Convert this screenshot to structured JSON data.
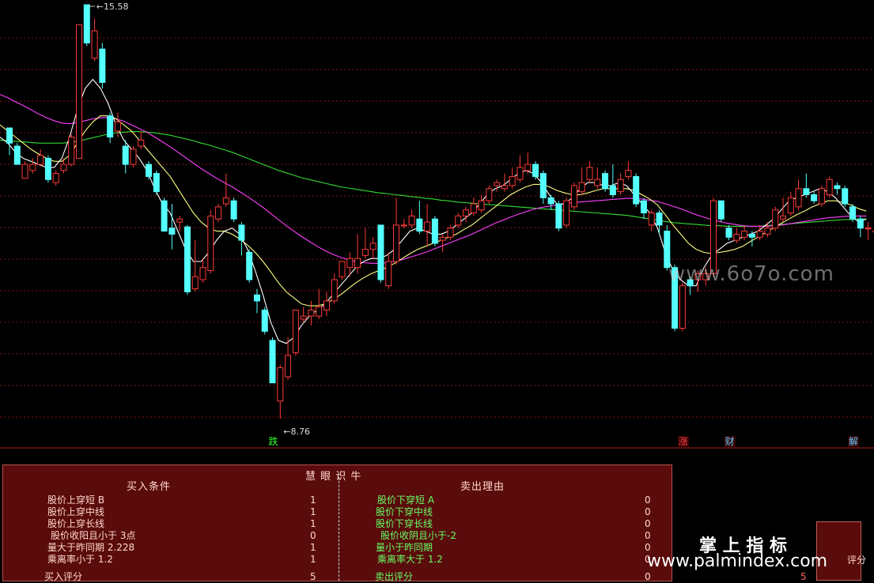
{
  "chart_data": {
    "type": "candlestick",
    "ylim": [
      8.5,
      15.8
    ],
    "price_high_label": "15.58",
    "price_low_label": "8.76",
    "colors": {
      "up": "#ff3a3a",
      "down": "#54ffff",
      "ma_short": "#ffffff",
      "ma_mid": "#ffff80",
      "ma_long": "#ff40ff",
      "ma_longest": "#33dd33"
    },
    "candles": [
      {
        "o": 13.55,
        "c": 13.3,
        "h": 13.55,
        "l": 13.1
      },
      {
        "o": 13.25,
        "c": 12.95,
        "h": 13.3,
        "l": 12.95
      },
      {
        "o": 12.72,
        "c": 12.95,
        "h": 13.0,
        "l": 12.75
      },
      {
        "o": 12.85,
        "c": 12.95,
        "h": 13.05,
        "l": 12.8
      },
      {
        "o": 12.95,
        "c": 13.1,
        "h": 13.2,
        "l": 12.92
      },
      {
        "o": 13.05,
        "c": 12.7,
        "h": 13.1,
        "l": 12.65
      },
      {
        "o": 12.65,
        "c": 12.8,
        "h": 12.85,
        "l": 12.6
      },
      {
        "o": 12.85,
        "c": 12.95,
        "h": 13.05,
        "l": 12.8
      },
      {
        "o": 12.95,
        "c": 13.4,
        "h": 13.45,
        "l": 12.92
      },
      {
        "o": 13.05,
        "c": 15.25,
        "h": 15.25,
        "l": 13.05
      },
      {
        "o": 15.58,
        "c": 14.95,
        "h": 15.58,
        "l": 14.9
      },
      {
        "o": 14.7,
        "c": 15.15,
        "h": 15.35,
        "l": 14.65
      },
      {
        "o": 14.85,
        "c": 14.3,
        "h": 14.95,
        "l": 14.2
      },
      {
        "o": 13.75,
        "c": 13.4,
        "h": 13.8,
        "l": 13.3
      },
      {
        "o": 13.5,
        "c": 13.65,
        "h": 13.8,
        "l": 13.4
      },
      {
        "o": 13.25,
        "c": 12.95,
        "h": 13.35,
        "l": 12.8
      },
      {
        "o": 12.95,
        "c": 13.2,
        "h": 13.25,
        "l": 12.9
      },
      {
        "o": 13.25,
        "c": 13.35,
        "h": 13.5,
        "l": 13.2
      },
      {
        "o": 12.95,
        "c": 12.75,
        "h": 13.0,
        "l": 12.7
      },
      {
        "o": 12.8,
        "c": 12.5,
        "h": 12.85,
        "l": 12.45
      },
      {
        "o": 12.35,
        "c": 11.85,
        "h": 12.4,
        "l": 11.85
      },
      {
        "o": 11.9,
        "c": 11.8,
        "h": 12.3,
        "l": 11.55
      },
      {
        "o": 12.0,
        "c": 12.05,
        "h": 12.1,
        "l": 11.85
      },
      {
        "o": 11.92,
        "c": 10.85,
        "h": 11.95,
        "l": 10.8
      },
      {
        "o": 10.9,
        "c": 11.1,
        "h": 11.7,
        "l": 10.85
      },
      {
        "o": 11.05,
        "c": 11.25,
        "h": 11.4,
        "l": 11.0
      },
      {
        "o": 11.2,
        "c": 12.1,
        "h": 12.2,
        "l": 11.15
      },
      {
        "o": 12.05,
        "c": 12.25,
        "h": 12.3,
        "l": 12.0
      },
      {
        "o": 12.3,
        "c": 12.4,
        "h": 12.8,
        "l": 12.25
      },
      {
        "o": 12.35,
        "c": 12.05,
        "h": 12.4,
        "l": 12.0
      },
      {
        "o": 11.95,
        "c": 11.7,
        "h": 12.0,
        "l": 11.45
      },
      {
        "o": 11.5,
        "c": 11.05,
        "h": 11.55,
        "l": 11.0
      },
      {
        "o": 10.8,
        "c": 10.7,
        "h": 10.9,
        "l": 10.5
      },
      {
        "o": 10.55,
        "c": 10.2,
        "h": 10.6,
        "l": 10.15
      },
      {
        "o": 10.05,
        "c": 9.35,
        "h": 10.1,
        "l": 9.35
      },
      {
        "o": 9.05,
        "c": 9.6,
        "h": 9.65,
        "l": 8.76
      },
      {
        "o": 9.45,
        "c": 9.8,
        "h": 10.1,
        "l": 9.4
      },
      {
        "o": 9.85,
        "c": 10.55,
        "h": 10.55,
        "l": 9.8
      },
      {
        "o": 10.4,
        "c": 10.45,
        "h": 10.6,
        "l": 10.35
      },
      {
        "o": 10.45,
        "c": 10.55,
        "h": 10.7,
        "l": 10.3
      },
      {
        "o": 10.45,
        "c": 10.6,
        "h": 10.9,
        "l": 10.4
      },
      {
        "o": 10.55,
        "c": 10.7,
        "h": 10.85,
        "l": 10.45
      },
      {
        "o": 10.7,
        "c": 11.05,
        "h": 11.15,
        "l": 10.65
      },
      {
        "o": 11.1,
        "c": 11.35,
        "h": 11.35,
        "l": 11.05
      },
      {
        "o": 11.25,
        "c": 11.4,
        "h": 11.5,
        "l": 11.1
      },
      {
        "o": 11.25,
        "c": 11.4,
        "h": 11.8,
        "l": 11.15
      },
      {
        "o": 11.45,
        "c": 11.55,
        "h": 11.9,
        "l": 11.4
      },
      {
        "o": 11.55,
        "c": 11.65,
        "h": 11.75,
        "l": 11.4
      },
      {
        "o": 11.95,
        "c": 11.05,
        "h": 11.95,
        "l": 11.0
      },
      {
        "o": 10.95,
        "c": 11.35,
        "h": 11.5,
        "l": 10.9
      },
      {
        "o": 11.35,
        "c": 11.95,
        "h": 12.4,
        "l": 11.3
      },
      {
        "o": 11.95,
        "c": 11.95,
        "h": 12.05,
        "l": 11.9
      },
      {
        "o": 11.95,
        "c": 12.1,
        "h": 12.2,
        "l": 11.9
      },
      {
        "o": 12.05,
        "c": 11.85,
        "h": 12.35,
        "l": 11.8
      },
      {
        "o": 11.85,
        "c": 12.0,
        "h": 12.3,
        "l": 11.6
      },
      {
        "o": 12.05,
        "c": 11.65,
        "h": 12.1,
        "l": 11.6
      },
      {
        "o": 11.7,
        "c": 11.75,
        "h": 11.8,
        "l": 11.5
      },
      {
        "o": 11.75,
        "c": 11.9,
        "h": 11.95,
        "l": 11.7
      },
      {
        "o": 11.95,
        "c": 12.1,
        "h": 12.15,
        "l": 11.9
      },
      {
        "o": 12.1,
        "c": 12.2,
        "h": 12.25,
        "l": 12.0
      },
      {
        "o": 12.15,
        "c": 12.3,
        "h": 12.4,
        "l": 12.1
      },
      {
        "o": 12.2,
        "c": 12.35,
        "h": 12.45,
        "l": 12.15
      },
      {
        "o": 12.35,
        "c": 12.55,
        "h": 12.6,
        "l": 12.3
      },
      {
        "o": 12.6,
        "c": 12.65,
        "h": 12.7,
        "l": 12.5
      },
      {
        "o": 12.55,
        "c": 12.6,
        "h": 12.8,
        "l": 12.5
      },
      {
        "o": 12.6,
        "c": 12.75,
        "h": 12.9,
        "l": 12.55
      },
      {
        "o": 12.7,
        "c": 12.9,
        "h": 13.1,
        "l": 12.65
      },
      {
        "o": 12.85,
        "c": 12.95,
        "h": 13.15,
        "l": 12.8
      },
      {
        "o": 12.95,
        "c": 12.75,
        "h": 13.0,
        "l": 12.7
      },
      {
        "o": 12.8,
        "c": 12.4,
        "h": 12.85,
        "l": 12.3
      },
      {
        "o": 12.4,
        "c": 12.3,
        "h": 12.45,
        "l": 12.2
      },
      {
        "o": 12.3,
        "c": 11.9,
        "h": 12.35,
        "l": 11.85
      },
      {
        "o": 11.95,
        "c": 12.35,
        "h": 12.4,
        "l": 11.9
      },
      {
        "o": 12.25,
        "c": 12.6,
        "h": 12.65,
        "l": 12.2
      },
      {
        "o": 12.5,
        "c": 12.65,
        "h": 12.9,
        "l": 12.45
      },
      {
        "o": 12.7,
        "c": 12.9,
        "h": 13.0,
        "l": 12.65
      },
      {
        "o": 12.6,
        "c": 12.7,
        "h": 12.9,
        "l": 12.55
      },
      {
        "o": 12.8,
        "c": 12.55,
        "h": 12.85,
        "l": 12.5
      },
      {
        "o": 12.6,
        "c": 12.45,
        "h": 12.95,
        "l": 12.4
      },
      {
        "o": 12.5,
        "c": 12.7,
        "h": 12.8,
        "l": 12.45
      },
      {
        "o": 12.75,
        "c": 12.85,
        "h": 13.0,
        "l": 12.7
      },
      {
        "o": 12.75,
        "c": 12.3,
        "h": 12.8,
        "l": 12.25
      },
      {
        "o": 12.35,
        "c": 12.15,
        "h": 12.4,
        "l": 12.05
      },
      {
        "o": 11.95,
        "c": 12.15,
        "h": 12.2,
        "l": 11.85
      },
      {
        "o": 12.15,
        "c": 11.95,
        "h": 12.2,
        "l": 11.8
      },
      {
        "o": 11.85,
        "c": 11.25,
        "h": 11.95,
        "l": 11.2
      },
      {
        "o": 11.25,
        "c": 10.25,
        "h": 11.3,
        "l": 10.2
      },
      {
        "o": 10.25,
        "c": 10.95,
        "h": 11.0,
        "l": 10.2
      },
      {
        "o": 11.05,
        "c": 10.95,
        "h": 11.1,
        "l": 10.8
      },
      {
        "o": 11.05,
        "c": 11.15,
        "h": 11.2,
        "l": 10.85
      },
      {
        "o": 11.05,
        "c": 11.15,
        "h": 11.25,
        "l": 10.95
      },
      {
        "o": 11.15,
        "c": 12.35,
        "h": 12.4,
        "l": 11.1
      },
      {
        "o": 12.35,
        "c": 12.05,
        "h": 12.35,
        "l": 12.0
      },
      {
        "o": 11.9,
        "c": 11.75,
        "h": 11.95,
        "l": 11.7
      },
      {
        "o": 11.7,
        "c": 11.8,
        "h": 11.9,
        "l": 11.65
      },
      {
        "o": 11.75,
        "c": 11.85,
        "h": 11.95,
        "l": 11.7
      },
      {
        "o": 11.8,
        "c": 11.75,
        "h": 11.85,
        "l": 11.6
      },
      {
        "o": 11.75,
        "c": 11.85,
        "h": 11.95,
        "l": 11.7
      },
      {
        "o": 11.8,
        "c": 11.9,
        "h": 12.0,
        "l": 11.75
      },
      {
        "o": 11.9,
        "c": 12.2,
        "h": 12.25,
        "l": 11.85
      },
      {
        "o": 12.05,
        "c": 12.1,
        "h": 12.4,
        "l": 12.0
      },
      {
        "o": 12.15,
        "c": 12.4,
        "h": 12.5,
        "l": 12.1
      },
      {
        "o": 12.25,
        "c": 12.55,
        "h": 12.7,
        "l": 12.2
      },
      {
        "o": 12.55,
        "c": 12.45,
        "h": 12.8,
        "l": 12.4
      },
      {
        "o": 12.45,
        "c": 12.35,
        "h": 12.5,
        "l": 12.3
      },
      {
        "o": 12.3,
        "c": 12.55,
        "h": 12.6,
        "l": 12.25
      },
      {
        "o": 12.45,
        "c": 12.7,
        "h": 12.75,
        "l": 12.4
      },
      {
        "o": 12.6,
        "c": 12.55,
        "h": 12.65,
        "l": 12.45
      },
      {
        "o": 12.55,
        "c": 12.3,
        "h": 12.6,
        "l": 12.25
      },
      {
        "o": 12.25,
        "c": 12.05,
        "h": 12.3,
        "l": 12.0
      },
      {
        "o": 12.05,
        "c": 11.9,
        "h": 12.1,
        "l": 11.75
      },
      {
        "o": 11.9,
        "c": 11.9,
        "h": 12.0,
        "l": 11.7
      },
      {
        "o": 11.85,
        "c": 11.85,
        "h": 11.85,
        "l": 11.55
      },
      {
        "o": 11.55,
        "c": 12.7,
        "h": 12.7,
        "l": 11.5
      }
    ],
    "ma_short": [
      13.4,
      13.3,
      13.15,
      13.05,
      13.0,
      12.95,
      12.9,
      12.9,
      13.05,
      13.4,
      13.85,
      14.2,
      14.35,
      14.2,
      13.95,
      13.6,
      13.35,
      13.2,
      13.05,
      12.85,
      12.55,
      12.3,
      12.15,
      11.85,
      11.55,
      11.35,
      11.35,
      11.5,
      11.7,
      11.85,
      11.9,
      11.8,
      11.55,
      11.2,
      10.8,
      10.35,
      10.05,
      10.0,
      10.1,
      10.3,
      10.45,
      10.55,
      10.65,
      10.8,
      10.95,
      11.1,
      11.25,
      11.35,
      11.4,
      11.4,
      11.45,
      11.55,
      11.7,
      11.85,
      11.9,
      11.85,
      11.8,
      11.8,
      11.85,
      11.95,
      12.05,
      12.15,
      12.3,
      12.45,
      12.55,
      12.6,
      12.7,
      12.8,
      12.85,
      12.8,
      12.65,
      12.45,
      12.3,
      12.3,
      12.4,
      12.55,
      12.65,
      12.65,
      12.6,
      12.6,
      12.65,
      12.6,
      12.45,
      12.3,
      12.15,
      11.9,
      11.5,
      11.2,
      11.05,
      10.95,
      10.95,
      11.25,
      11.45,
      11.55,
      11.65,
      11.7,
      11.75,
      11.8,
      11.85,
      11.95,
      12.05,
      12.2,
      12.35,
      12.4,
      12.45,
      12.5,
      12.55,
      12.5,
      12.4,
      12.25,
      12.1,
      12.0,
      12.05
    ],
    "ma_mid": [
      13.6,
      13.5,
      13.4,
      13.3,
      13.2,
      13.12,
      13.05,
      13.0,
      13.0,
      13.1,
      13.3,
      13.5,
      13.65,
      13.75,
      13.75,
      13.7,
      13.6,
      13.5,
      13.35,
      13.2,
      13.05,
      12.9,
      12.75,
      12.55,
      12.35,
      12.15,
      12.0,
      11.9,
      11.85,
      11.85,
      11.8,
      11.72,
      11.62,
      11.5,
      11.35,
      11.18,
      11.0,
      10.85,
      10.75,
      10.65,
      10.62,
      10.62,
      10.65,
      10.72,
      10.8,
      10.9,
      11.0,
      11.08,
      11.15,
      11.2,
      11.25,
      11.32,
      11.4,
      11.48,
      11.55,
      11.6,
      11.65,
      11.7,
      11.75,
      11.8,
      11.88,
      11.95,
      12.05,
      12.15,
      12.25,
      12.35,
      12.45,
      12.52,
      12.58,
      12.62,
      12.62,
      12.58,
      12.52,
      12.48,
      12.45,
      12.45,
      12.48,
      12.52,
      12.55,
      12.55,
      12.55,
      12.55,
      12.52,
      12.45,
      12.38,
      12.28,
      12.12,
      11.95,
      11.8,
      11.65,
      11.55,
      11.5,
      11.48,
      11.5,
      11.52,
      11.55,
      11.6,
      11.68,
      11.75,
      11.83,
      11.9,
      11.98,
      12.05,
      12.12,
      12.18,
      12.25,
      12.3,
      12.35,
      12.35,
      12.32,
      12.28,
      12.22,
      12.18
    ],
    "ma_long": [
      14.1,
      14.05,
      13.98,
      13.92,
      13.85,
      13.78,
      13.72,
      13.67,
      13.63,
      13.62,
      13.64,
      13.67,
      13.7,
      13.72,
      13.72,
      13.7,
      13.66,
      13.6,
      13.54,
      13.48,
      13.4,
      13.32,
      13.24,
      13.15,
      13.06,
      12.97,
      12.88,
      12.8,
      12.72,
      12.65,
      12.58,
      12.5,
      12.42,
      12.33,
      12.24,
      12.14,
      12.04,
      11.94,
      11.85,
      11.76,
      11.68,
      11.6,
      11.53,
      11.47,
      11.42,
      11.38,
      11.35,
      11.33,
      11.32,
      11.32,
      11.33,
      11.35,
      11.38,
      11.42,
      11.46,
      11.5,
      11.55,
      11.6,
      11.65,
      11.7,
      11.75,
      11.8,
      11.86,
      11.92,
      11.98,
      12.03,
      12.08,
      12.13,
      12.17,
      12.21,
      12.24,
      12.26,
      12.28,
      12.3,
      12.32,
      12.33,
      12.34,
      12.35,
      12.36,
      12.37,
      12.38,
      12.39,
      12.39,
      12.38,
      12.36,
      12.34,
      12.3,
      12.26,
      12.22,
      12.17,
      12.12,
      12.08,
      12.04,
      12.01,
      11.98,
      11.96,
      11.94,
      11.93,
      11.93,
      11.93,
      11.94,
      11.95,
      11.97,
      11.99,
      12.01,
      12.03,
      12.05,
      12.07,
      12.08,
      12.09,
      12.1,
      12.1,
      12.1
    ],
    "ma_longest": [
      13.35,
      13.34,
      13.33,
      13.32,
      13.31,
      13.3,
      13.3,
      13.3,
      13.3,
      13.31,
      13.33,
      13.36,
      13.39,
      13.42,
      13.45,
      13.47,
      13.48,
      13.49,
      13.49,
      13.48,
      13.47,
      13.45,
      13.43,
      13.4,
      13.37,
      13.34,
      13.3,
      13.27,
      13.23,
      13.19,
      13.15,
      13.1,
      13.05,
      13.0,
      12.95,
      12.9,
      12.85,
      12.81,
      12.77,
      12.73,
      12.7,
      12.67,
      12.64,
      12.61,
      12.58,
      12.56,
      12.54,
      12.52,
      12.5,
      12.48,
      12.47,
      12.45,
      12.44,
      12.42,
      12.41,
      12.39,
      12.38,
      12.36,
      12.35,
      12.33,
      12.32,
      12.31,
      12.3,
      12.29,
      12.28,
      12.27,
      12.26,
      12.25,
      12.24,
      12.23,
      12.22,
      12.21,
      12.2,
      12.19,
      12.18,
      12.17,
      12.16,
      12.15,
      12.14,
      12.13,
      12.12,
      12.11,
      12.09,
      12.07,
      12.05,
      12.03,
      12.01,
      11.99,
      11.98,
      11.97,
      11.96,
      11.95,
      11.94,
      11.94,
      11.93,
      11.93,
      11.93,
      11.93,
      11.93,
      11.94,
      11.95,
      11.96,
      11.97,
      11.98,
      11.99,
      12.0,
      12.01,
      12.02,
      12.03,
      12.04,
      12.04,
      12.05,
      12.05
    ],
    "signals": [
      {
        "index": 34,
        "label": "跌",
        "color": "#33ff33"
      },
      {
        "index": 87,
        "label": "涨",
        "color": "#ff4444"
      },
      {
        "index": 93,
        "label": "财",
        "color": "#66ccff"
      },
      {
        "index": 109,
        "label": "解",
        "color": "#66ccff"
      }
    ]
  },
  "panel": {
    "title": "慧 眼 识 牛",
    "buy": {
      "header": "买入条件",
      "rows": [
        {
          "label": "股价上穿短 B",
          "value": "1"
        },
        {
          "label": "股价上穿中线",
          "value": "1"
        },
        {
          "label": "股价上穿长线",
          "value": "1"
        },
        {
          "label": "股价收阳且小于 3点",
          "value": "0"
        },
        {
          "label": "量大于昨同期   2.228",
          "value": "1"
        },
        {
          "label": "乘离率小于 1.2",
          "value": "1"
        }
      ],
      "score_label": "买入评分",
      "score_value": "5"
    },
    "sell": {
      "header": "卖出理由",
      "rows": [
        {
          "label": "股价下穿短 A",
          "value": "0"
        },
        {
          "label": "股价下穿中线",
          "value": "0"
        },
        {
          "label": "股价下穿长线",
          "value": "0"
        },
        {
          "label": "股价收阴且小于-2",
          "value": "0"
        },
        {
          "label": "量小于昨同期",
          "value": "0"
        },
        {
          "label": "乘离率大于 1.2",
          "value": "0"
        }
      ],
      "score_label": "卖出评分",
      "score_value": "0"
    }
  },
  "score_box": {
    "value": "5",
    "label": "评分"
  },
  "watermarks": {
    "top": "www.6o7o.com",
    "brand": "掌 上 指 标",
    "url": "www.palmindex.com"
  }
}
